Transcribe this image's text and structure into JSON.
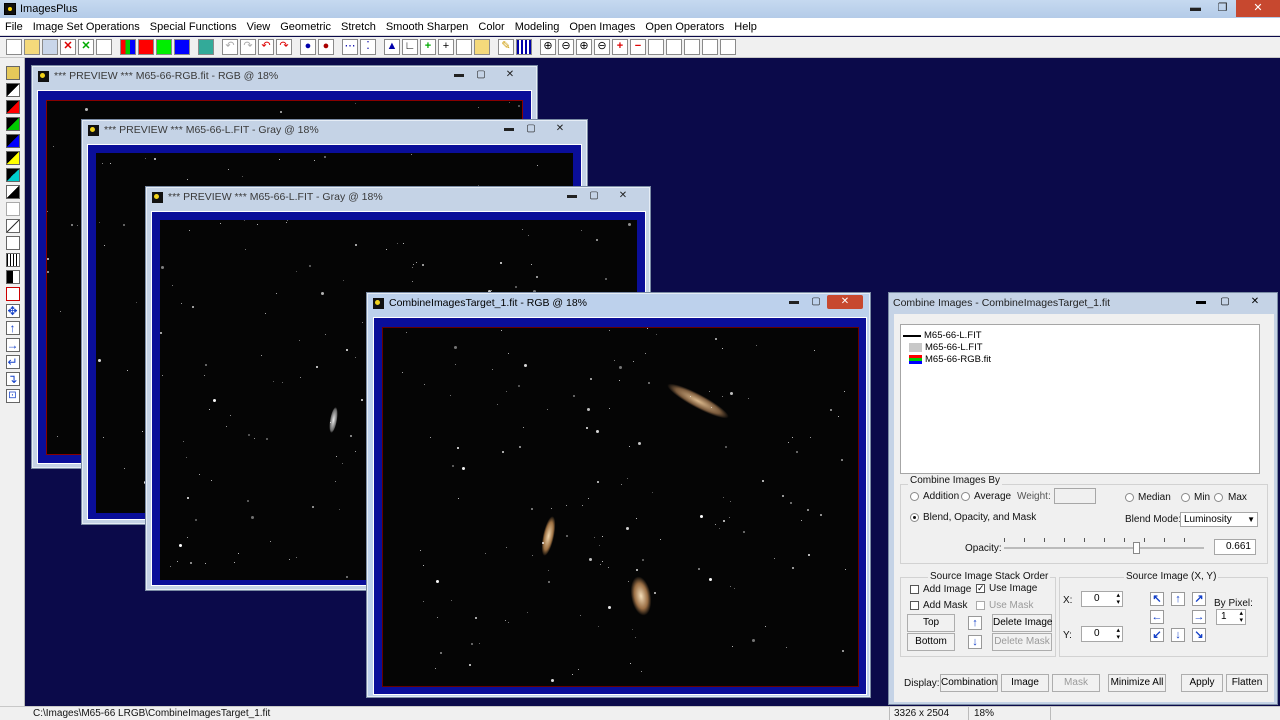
{
  "app": {
    "title": "ImagesPlus",
    "minimize": "▬",
    "maximize": "❐",
    "close": "✕"
  },
  "menu": [
    "File",
    "Image Set Operations",
    "Special Functions",
    "View",
    "Geometric",
    "Stretch",
    "Smooth Sharpen",
    "Color",
    "Modeling",
    "Open Images",
    "Open Operators",
    "Help"
  ],
  "windows": [
    {
      "title": "*** PREVIEW *** M65-66-RGB.fit - RGB @ 18%"
    },
    {
      "title": "*** PREVIEW *** M65-66-L.FIT - Gray @ 18%"
    },
    {
      "title": "*** PREVIEW *** M65-66-L.FIT - Gray @ 18%"
    },
    {
      "title": "CombineImagesTarget_1.fit - RGB @ 18%"
    }
  ],
  "win_buttons": {
    "minimize": "▬",
    "maximize": "▢",
    "close": "✕"
  },
  "combine": {
    "title": "Combine Images - CombineImagesTarget_1.fit",
    "stack": [
      "M65-66-L.FIT",
      "M65-66-L.FIT",
      "M65-66-RGB.fit"
    ],
    "combine_by_label": "Combine Images By",
    "addition": "Addition",
    "average": "Average",
    "weight_label": "Weight:",
    "median": "Median",
    "min": "Min",
    "max": "Max",
    "blend": "Blend, Opacity, and Mask",
    "blend_mode_label": "Blend Mode:",
    "blend_mode_value": "Luminosity",
    "opacity_label": "Opacity:",
    "opacity_value": "0.661",
    "opacity_fraction": 0.661,
    "stack_order_label": "Source Image Stack Order",
    "add_image": "Add Image",
    "use_image": "Use Image",
    "add_mask": "Add Mask",
    "use_mask": "Use Mask",
    "top": "Top",
    "bottom": "Bottom",
    "delete_image": "Delete Image",
    "delete_mask": "Delete Mask",
    "source_xy_label": "Source Image (X, Y)",
    "x_label": "X:",
    "x_value": "0",
    "y_label": "Y:",
    "y_value": "0",
    "by_pixel_label": "By Pixel:",
    "by_pixel_value": "1",
    "display_label": "Display:",
    "btn_combination": "Combination",
    "btn_image": "Image",
    "btn_mask": "Mask",
    "btn_minimize_all": "Minimize All",
    "btn_apply": "Apply",
    "btn_flatten": "Flatten"
  },
  "status": {
    "path": "C:\\Images\\M65-66 LRGB\\CombineImagesTarget_1.fit",
    "dims": "3326 x 2504",
    "zoom": "18%"
  }
}
